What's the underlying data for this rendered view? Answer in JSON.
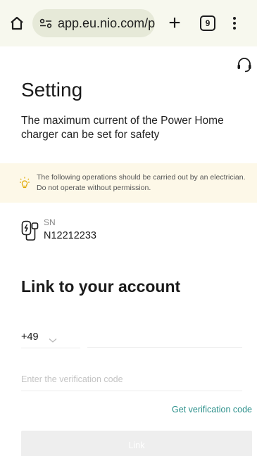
{
  "browser": {
    "url": "app.eu.nio.com/p",
    "tab_count": "9",
    "icons": {
      "home": "home-icon",
      "site_info": "site-info-icon",
      "new_tab": "plus-icon",
      "tabs": "tab-count-icon",
      "menu": "more-vertical-icon"
    }
  },
  "header": {
    "support_icon": "headset-icon"
  },
  "page": {
    "title": "Setting",
    "description": "The maximum current of the Power Home charger can be set for safety"
  },
  "warning": {
    "icon": "lightbulb-icon",
    "text": "The following operations should be carried out by an electrician. Do not operate without permission."
  },
  "device": {
    "icon": "charger-icon",
    "sn_label": "SN",
    "sn_value": "N12212233"
  },
  "account": {
    "title": "Link to your account",
    "country_code": "+49",
    "phone_placeholder": "",
    "code_placeholder": "Enter the verification code",
    "get_code_label": "Get verification code",
    "link_button_label": "Link"
  },
  "colors": {
    "browser_bar": "#f7f8ee",
    "url_pill": "#e6e9d8",
    "warning_bg": "#fdf8e8",
    "accent_link": "#2a8f8a",
    "button_disabled": "#eeeeee"
  }
}
